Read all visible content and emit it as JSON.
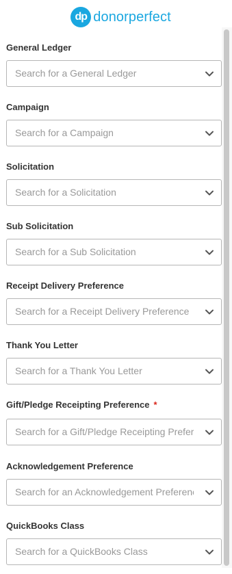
{
  "brand": {
    "mark": "dp",
    "name": "donorperfect",
    "color": "#1aa7e0"
  },
  "fields": [
    {
      "label": "General Ledger",
      "placeholder": "Search for a General Ledger",
      "required": false
    },
    {
      "label": "Campaign",
      "placeholder": "Search for a Campaign",
      "required": false
    },
    {
      "label": "Solicitation",
      "placeholder": "Search for a Solicitation",
      "required": false
    },
    {
      "label": "Sub Solicitation",
      "placeholder": "Search for a Sub Solicitation",
      "required": false
    },
    {
      "label": "Receipt Delivery Preference",
      "placeholder": "Search for a Receipt Delivery Preference",
      "required": false
    },
    {
      "label": "Thank You Letter",
      "placeholder": "Search for a Thank You Letter",
      "required": false
    },
    {
      "label": "Gift/Pledge Receipting Preference",
      "placeholder": "Search for a Gift/Pledge Receipting Preference",
      "required": true
    },
    {
      "label": "Acknowledgement Preference",
      "placeholder": "Search for an Acknowledgement Preference",
      "required": false
    },
    {
      "label": "QuickBooks Class",
      "placeholder": "Search for a QuickBooks Class",
      "required": false
    }
  ],
  "required_marker": "*",
  "icons": {
    "dropdown": "chevron-down-icon"
  },
  "colors": {
    "required": "#d9261c",
    "placeholder": "#999999",
    "border": "#b5b5b5"
  }
}
